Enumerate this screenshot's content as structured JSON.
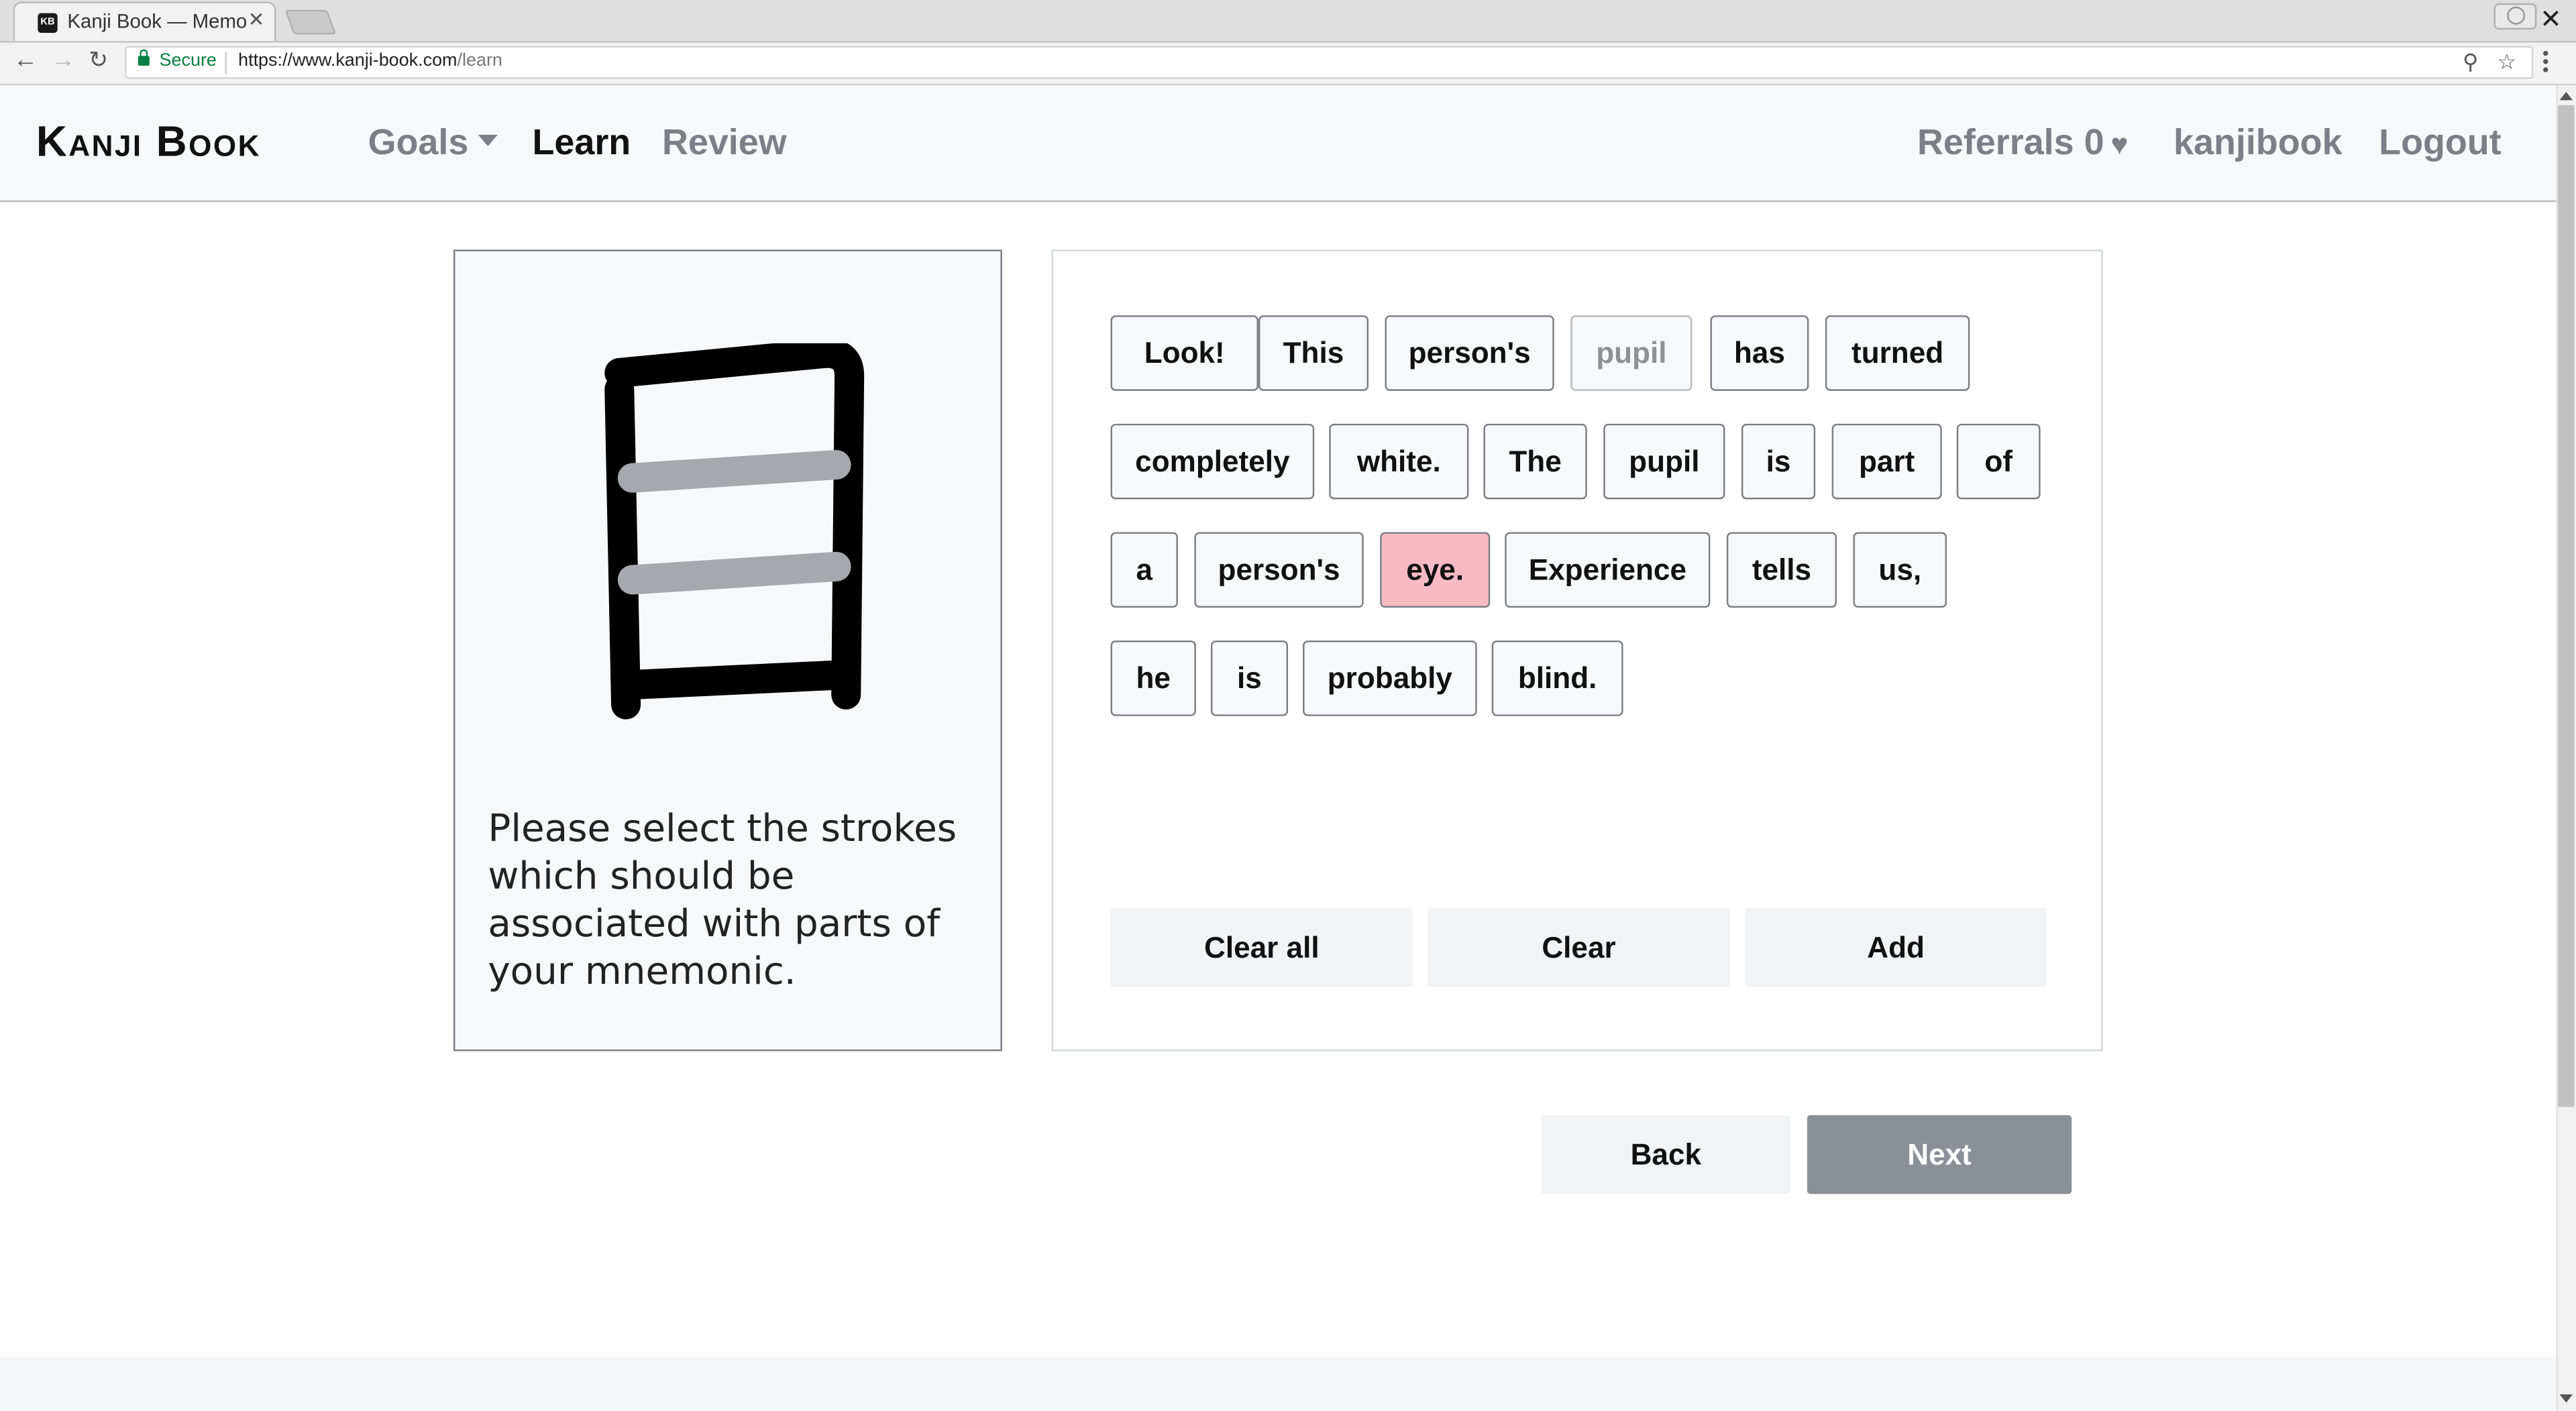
{
  "browser": {
    "tab_title": "Kanji Book — Memo",
    "tab_favicon": "KB",
    "secure_label": "Secure",
    "url_host": "https://www.kanji-book.com",
    "url_path": "/learn"
  },
  "header": {
    "logo": "Kanji Book",
    "nav": {
      "goals": "Goals",
      "learn": "Learn",
      "review": "Review"
    },
    "referrals": "Referrals 0",
    "username": "kanjibook",
    "logout": "Logout"
  },
  "kanji_panel": {
    "kanji": "目",
    "stroke_colors": {
      "selected": "#000000",
      "unselected": "#a5a9ae"
    },
    "instruction": "Please select the strokes which should be associated with parts of your mnemonic."
  },
  "mnemonic": {
    "words": [
      {
        "text": "Look!",
        "state": "normal"
      },
      {
        "text": "This",
        "state": "normal"
      },
      {
        "text": "person's",
        "state": "normal"
      },
      {
        "text": "pupil",
        "state": "disabled"
      },
      {
        "text": "has",
        "state": "normal"
      },
      {
        "text": "turned",
        "state": "normal"
      },
      {
        "text": "completely",
        "state": "normal"
      },
      {
        "text": "white.",
        "state": "normal"
      },
      {
        "text": "The",
        "state": "normal"
      },
      {
        "text": "pupil",
        "state": "normal"
      },
      {
        "text": "is",
        "state": "normal"
      },
      {
        "text": "part",
        "state": "normal"
      },
      {
        "text": "of",
        "state": "normal"
      },
      {
        "text": "a",
        "state": "normal"
      },
      {
        "text": "person's",
        "state": "normal"
      },
      {
        "text": "eye.",
        "state": "selected"
      },
      {
        "text": "Experience",
        "state": "normal"
      },
      {
        "text": "tells",
        "state": "normal"
      },
      {
        "text": "us,",
        "state": "normal"
      },
      {
        "text": "he",
        "state": "normal"
      },
      {
        "text": "is",
        "state": "normal"
      },
      {
        "text": "probably",
        "state": "normal"
      },
      {
        "text": "blind.",
        "state": "normal"
      }
    ],
    "buttons": {
      "clear_all": "Clear all",
      "clear": "Clear",
      "add": "Add"
    }
  },
  "footer_nav": {
    "back": "Back",
    "next": "Next"
  },
  "colors": {
    "selected_word": "#f7b9c4",
    "next_button": "#8b9096",
    "secure_green": "#0b8043"
  }
}
